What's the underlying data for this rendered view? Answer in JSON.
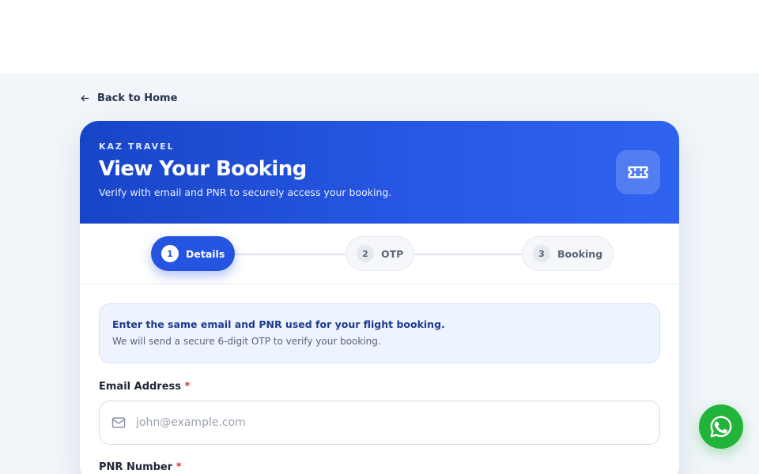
{
  "nav": {
    "back_label": "Back to Home"
  },
  "header": {
    "brand": "KAZ TRAVEL",
    "title": "View Your Booking",
    "subtitle": "Verify with email and PNR to securely access your booking."
  },
  "steps": [
    {
      "number": "1",
      "label": "Details",
      "state": "active"
    },
    {
      "number": "2",
      "label": "OTP",
      "state": "inactive"
    },
    {
      "number": "3",
      "label": "Booking",
      "state": "inactive"
    }
  ],
  "info": {
    "title": "Enter the same email and PNR used for your flight booking.",
    "text": "We will send a secure 6-digit OTP to verify your booking."
  },
  "form": {
    "email_label": "Email Address",
    "email_placeholder": "john@example.com",
    "email_value": "",
    "pnr_label": "PNR Number",
    "required_mark": "*"
  },
  "colors": {
    "accent": "#2454e0",
    "header_gradient_start": "#1845c7",
    "header_gradient_end": "#2f63ef",
    "whatsapp": "#22b33a",
    "required": "#e03232"
  },
  "icons": {
    "back": "arrow-left-icon",
    "header": "ticket-icon",
    "email": "mail-icon",
    "chat": "whatsapp-icon"
  }
}
